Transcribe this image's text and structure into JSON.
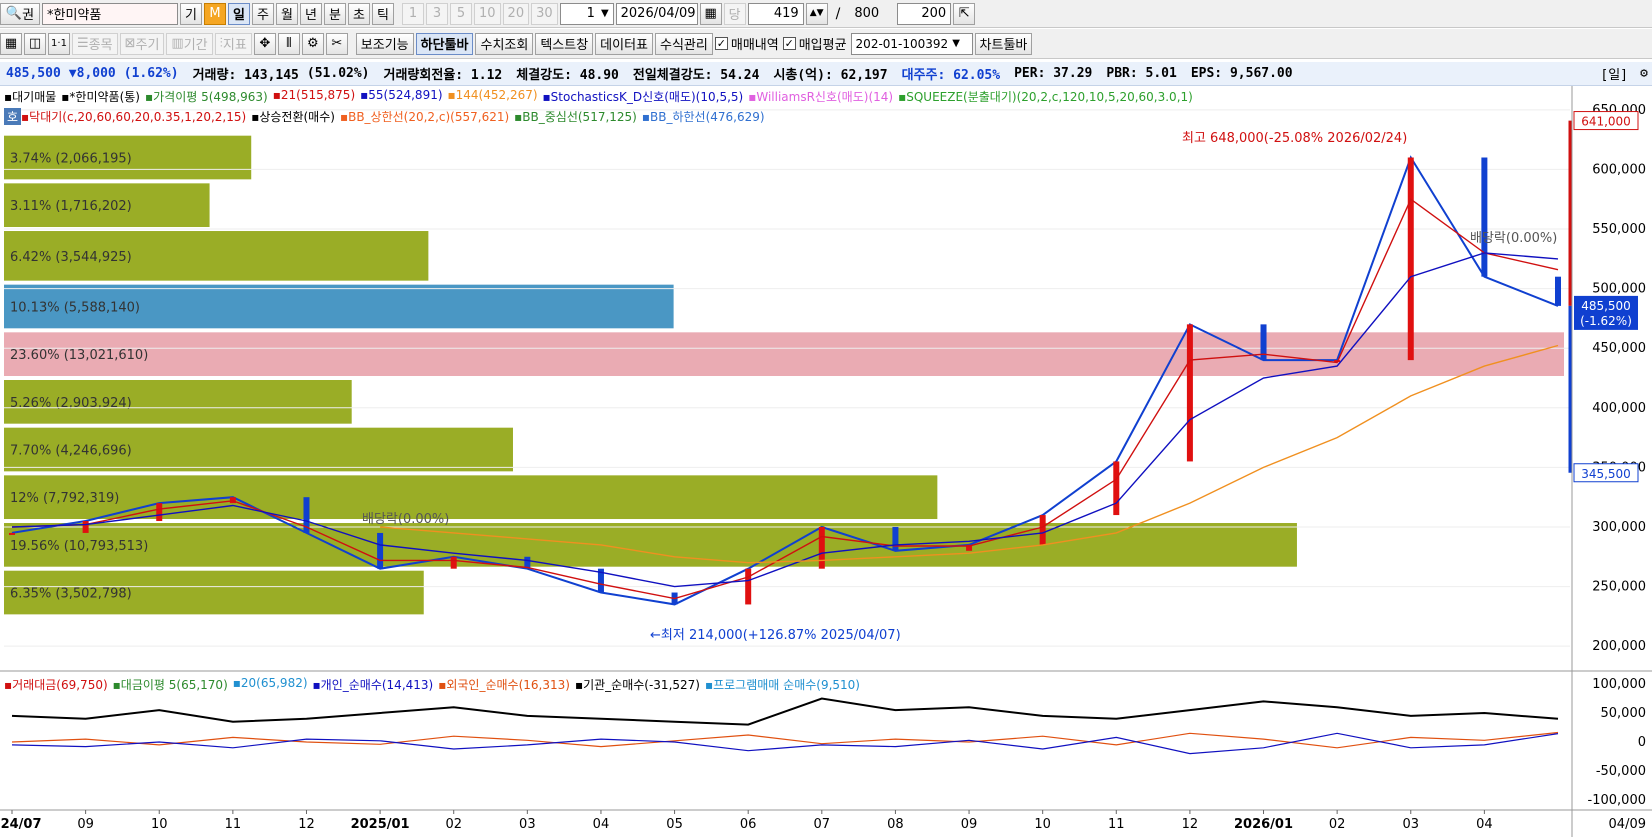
{
  "toolbar1": {
    "search_label": "권",
    "stock_name": "*한미약품",
    "period_buttons": [
      "일",
      "주",
      "월",
      "년",
      "분",
      "초",
      "틱"
    ],
    "period_prefix": [
      "기",
      "M"
    ],
    "minute_buttons": [
      "1",
      "3",
      "5",
      "10",
      "20",
      "30"
    ],
    "count_value": "1",
    "date_value": "2026/04/09",
    "dang_label": "당",
    "page_current": "419",
    "page_sep": "/",
    "page_total": "800",
    "view_count": "200"
  },
  "toolbar2": {
    "disabled_buttons": [
      "종목",
      "주기",
      "기간",
      "지표"
    ],
    "buttons": [
      "보조기능",
      "하단툴바",
      "수치조회",
      "텍스트창",
      "데이터표",
      "수식관리"
    ],
    "checkbox_trades": "매매내역",
    "checkbox_avg": "매입평균",
    "account_value": "202-01-100392",
    "chart_toolbar_button": "차트툴바"
  },
  "infobar": {
    "price": "485,500",
    "change": "▼8,000",
    "change_pct": "(1.62%)",
    "volume": "거래량: 143,145",
    "volume_pct": "(51.02%)",
    "turnover": "거래량회전율: 1.12",
    "strength": "체결강도: 48.90",
    "prev_strength": "전일체결강도: 54.24",
    "market_cap": "시총(억): 62,197",
    "major_holder": "대주주: 62.05%",
    "per": "PER: 37.29",
    "pbr": "PBR: 5.01",
    "eps": "EPS: 9,567.00",
    "period_tag": "[일]"
  },
  "legend": {
    "row1": [
      {
        "text": "대기매물",
        "color": "#000000"
      },
      {
        "text": "*한미약품(통)",
        "color": "#000000"
      },
      {
        "text": "가격이평 5(498,963)",
        "color": "#2d8a2d"
      },
      {
        "text": "21(515,875)",
        "color": "#d01010"
      },
      {
        "text": "55(524,891)",
        "color": "#1010c0"
      },
      {
        "text": "144(452,267)",
        "color": "#f09020"
      },
      {
        "text": "StochasticsK_D신호(매도)(10,5,5)",
        "color": "#1010c0"
      },
      {
        "text": "WilliamsR신호(매도)(14)",
        "color": "#e060e0"
      },
      {
        "text": "SQUEEZE(분출대기)(20,2,c,120,10,5,20,60,3.0,1)",
        "color": "#2da02d"
      }
    ],
    "row2_badge": "호",
    "row2": [
      {
        "text": "닥대기(c,20,60,60,20,0.35,1,20,2,15)",
        "color": "#d01010"
      },
      {
        "text": "상승전환(매수)",
        "color": "#000000"
      },
      {
        "text": "BB_상한선(20,2,c)(557,621)",
        "color": "#f06020"
      },
      {
        "text": "BB_중심선(517,125)",
        "color": "#2d8a2d"
      },
      {
        "text": "BB_하한선(476,629)",
        "color": "#3070d0"
      }
    ],
    "lower": [
      {
        "text": "거래대금(69,750)",
        "color": "#d01010"
      },
      {
        "text": "대금이평 5(65,170)",
        "color": "#2d8a2d"
      },
      {
        "text": "20(65,982)",
        "color": "#2090d0"
      },
      {
        "text": "개인_순매수(14,413)",
        "color": "#1010c0"
      },
      {
        "text": "외국인_순매수(16,313)",
        "color": "#e05010"
      },
      {
        "text": "기관_순매수(-31,527)",
        "color": "#000000"
      },
      {
        "text": "프로그램매매 순매수(9,510)",
        "color": "#2090d0"
      }
    ]
  },
  "annotations": {
    "high": "최고 648,000(-25.08% 2026/02/24)",
    "low": "←최저 214,000(+126.87% 2025/04/07)",
    "dividend1": "배당락(0.00%)",
    "dividend2": "배당락(0.00%)"
  },
  "price_tags": {
    "top": "641,000",
    "current": "485,500",
    "current_pct": "(-1.62%)",
    "bottom": "345,500"
  },
  "colors": {
    "up": "#e01010",
    "down": "#1040d0",
    "volume_profile": "#9aad26",
    "volume_profile_current": "#4a97c4",
    "volume_profile_max": "#e596a0"
  },
  "axis_end_label": "04/09",
  "chart_data": [
    {
      "type": "line",
      "title": "",
      "x": [
        "2024/07",
        "2024/08",
        "2024/09",
        "2024/10",
        "2024/11",
        "2024/12",
        "2025/01",
        "2025/02",
        "2025/03",
        "2025/04",
        "2025/05",
        "2025/06",
        "2025/07",
        "2025/08",
        "2025/09",
        "2025/10",
        "2025/11",
        "2025/12",
        "2026/01",
        "2026/02",
        "2026/03",
        "2026/04"
      ],
      "x_tick_labels": [
        "2024/07",
        "09",
        "10",
        "11",
        "12",
        "2025/01",
        "02",
        "03",
        "04",
        "05",
        "06",
        "07",
        "08",
        "09",
        "10",
        "11",
        "12",
        "2026/01",
        "02",
        "03",
        "04"
      ],
      "series": [
        {
          "name": "*한미약품(통)",
          "values": [
            295000,
            305000,
            320000,
            325000,
            295000,
            265000,
            275000,
            265000,
            245000,
            235000,
            265000,
            300000,
            280000,
            285000,
            310000,
            355000,
            470000,
            440000,
            440000,
            610000,
            510000,
            485500
          ]
        },
        {
          "name": "21",
          "values": [
            300000,
            302000,
            315000,
            322000,
            300000,
            272000,
            272000,
            266000,
            252000,
            240000,
            258000,
            292000,
            284000,
            284000,
            300000,
            340000,
            440000,
            445000,
            438000,
            575000,
            530000,
            515875
          ]
        },
        {
          "name": "55",
          "values": [
            300000,
            302000,
            310000,
            318000,
            305000,
            285000,
            278000,
            272000,
            262000,
            250000,
            255000,
            278000,
            285000,
            288000,
            295000,
            320000,
            390000,
            425000,
            435000,
            510000,
            530000,
            524891
          ]
        },
        {
          "name": "144",
          "values": [
            null,
            null,
            null,
            null,
            null,
            300000,
            295000,
            290000,
            285000,
            275000,
            270000,
            272000,
            275000,
            278000,
            285000,
            295000,
            320000,
            350000,
            375000,
            410000,
            435000,
            452267
          ]
        }
      ],
      "ylim": [
        180000,
        670000
      ],
      "y_ticks": [
        "200,000",
        "250,000",
        "300,000",
        "350,000",
        "400,000",
        "450,000",
        "500,000",
        "550,000",
        "600,000",
        "650,000"
      ],
      "volume_profile": [
        {
          "label": "3.74% (2,066,195)",
          "pct": 3.74,
          "price_low": 590000,
          "price_high": 630000
        },
        {
          "label": "3.11% (1,716,202)",
          "pct": 3.11,
          "price_low": 550000,
          "price_high": 590000
        },
        {
          "label": "6.42% (3,544,925)",
          "pct": 6.42,
          "price_low": 505000,
          "price_high": 550000
        },
        {
          "label": "10.13% (5,588,140)",
          "pct": 10.13,
          "price_low": 465000,
          "price_high": 505000
        },
        {
          "label": "23.60% (13,021,610)",
          "pct": 23.6,
          "price_low": 425000,
          "price_high": 465000
        },
        {
          "label": "5.26% (2,903,924)",
          "pct": 5.26,
          "price_low": 385000,
          "price_high": 425000
        },
        {
          "label": "7.70% (4,246,696)",
          "pct": 7.7,
          "price_low": 345000,
          "price_high": 385000
        },
        {
          "label": "12% (7,792,319)",
          "pct": 14.12,
          "price_low": 305000,
          "price_high": 345000
        },
        {
          "label": "19.56% (10,793,513)",
          "pct": 19.56,
          "price_low": 265000,
          "price_high": 305000
        },
        {
          "label": "6.35% (3,502,798)",
          "pct": 6.35,
          "price_low": 225000,
          "price_high": 265000
        }
      ]
    },
    {
      "type": "line",
      "title": "",
      "ylim": [
        -100000,
        100000
      ],
      "y_ticks": [
        "100,000",
        "50,000",
        "0",
        "-50,000",
        "-100,000"
      ],
      "series": [
        {
          "name": "기관_순매수",
          "values": [
            45000,
            40000,
            55000,
            35000,
            40000,
            50000,
            60000,
            45000,
            40000,
            35000,
            30000,
            75000,
            55000,
            60000,
            45000,
            40000,
            55000,
            70000,
            60000,
            45000,
            50000,
            40000
          ]
        },
        {
          "name": "외국인_순매수",
          "values": [
            0,
            5000,
            -5000,
            8000,
            0,
            -4000,
            10000,
            3000,
            -8000,
            2000,
            12000,
            -3000,
            5000,
            0,
            10000,
            -5000,
            15000,
            5000,
            -10000,
            8000,
            3000,
            16313
          ]
        },
        {
          "name": "개인_순매수",
          "values": [
            -5000,
            -8000,
            0,
            -10000,
            5000,
            2000,
            -12000,
            -5000,
            5000,
            0,
            -15000,
            -5000,
            -8000,
            3000,
            -12000,
            8000,
            -20000,
            -10000,
            15000,
            -10000,
            -5000,
            14413
          ]
        }
      ]
    }
  ]
}
